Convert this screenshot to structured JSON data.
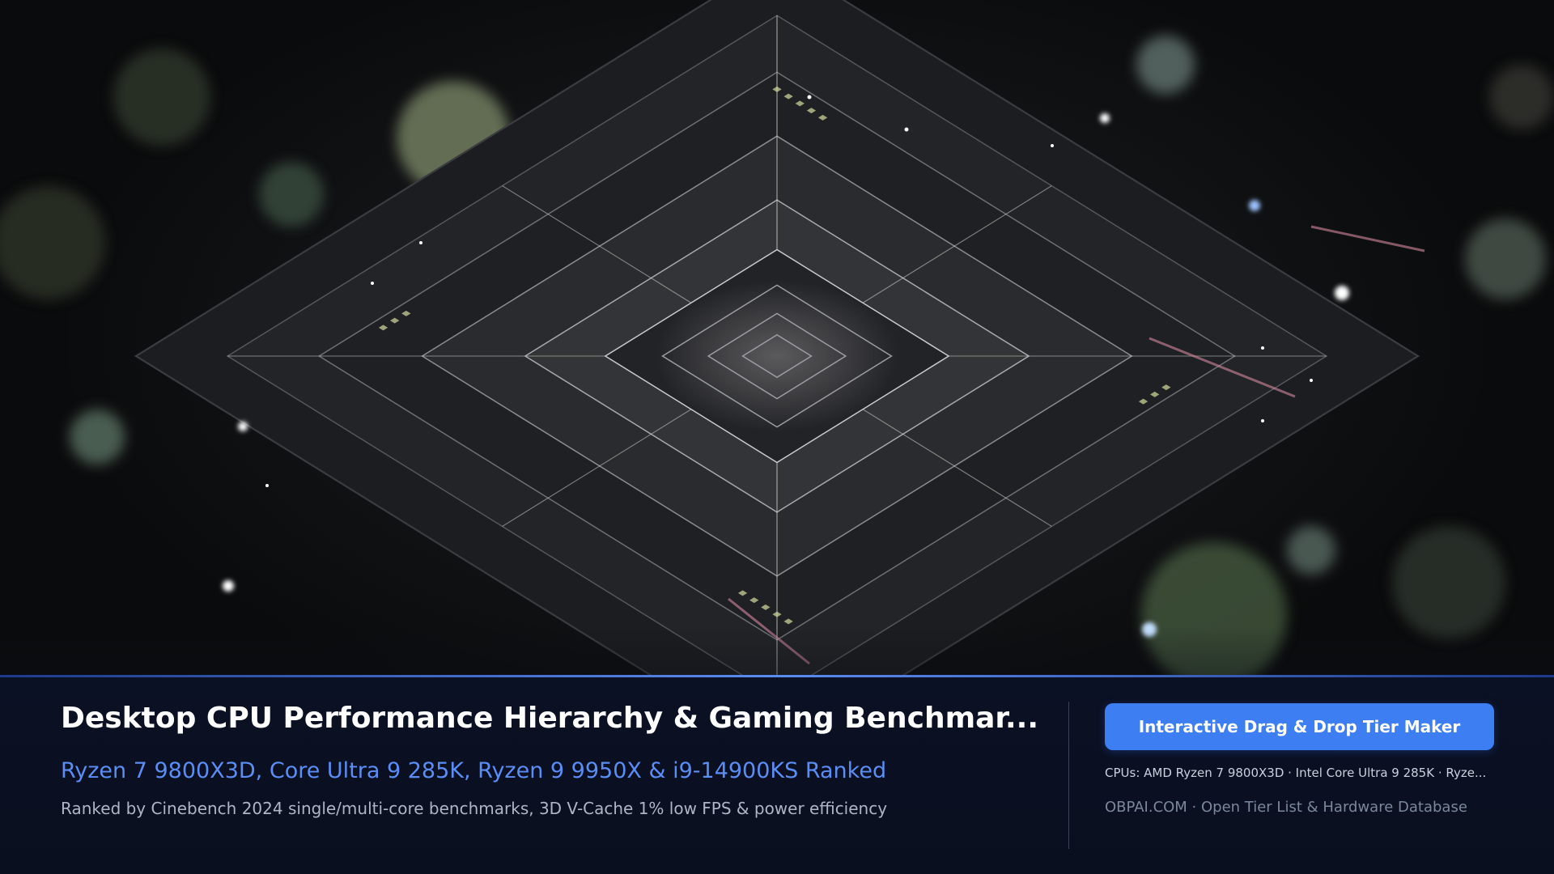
{
  "hero": {
    "image_icon": "cpu-chip-macro-image"
  },
  "footer": {
    "title": "Desktop CPU Performance Hierarchy & Gaming Benchmar...",
    "subtitle": "Ryzen 7 9800X3D, Core Ultra 9 285K, Ryzen 9 9950X & i9-14900KS Ranked",
    "description": "Ranked by Cinebench 2024 single/multi-core benchmarks, 3D V-Cache 1% low FPS & power efficiency",
    "cta_label": "Interactive Drag & Drop Tier Maker",
    "cpus_line": "CPUs: AMD Ryzen 7 9800X3D · Intel Core Ultra 9 285K · Ryze...",
    "site_line": "OBPAI.COM · Open Tier List & Hardware Database"
  },
  "colors": {
    "accent": "#3d7ef3",
    "subtitle": "#5b8ef5",
    "footer_bg": "#0b1124"
  }
}
